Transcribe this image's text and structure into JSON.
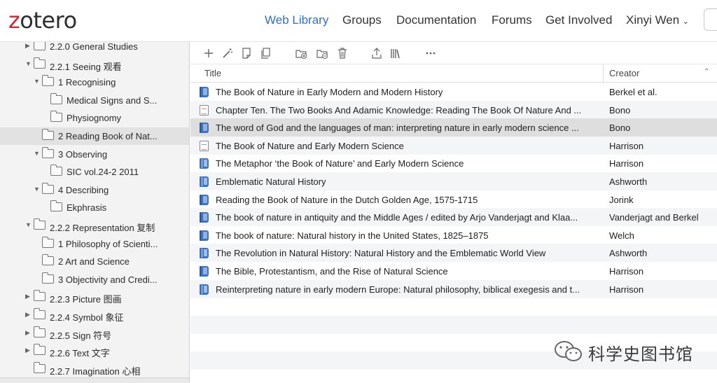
{
  "header": {
    "logo_first": "z",
    "logo_rest": "otero",
    "nav": [
      "Web Library",
      "Groups",
      "Documentation",
      "Forums",
      "Get Involved"
    ],
    "active_nav": "Web Library",
    "user": "Xinyi Wen"
  },
  "sidebar": {
    "items": [
      {
        "label": "2.2.0 General Studies",
        "expanded": false
      },
      {
        "label": "2.2.1 Seeing 观看",
        "expanded": true
      },
      {
        "label": "1 Recognising",
        "expanded": true
      },
      {
        "label": "Medical Signs and S...",
        "expanded": null
      },
      {
        "label": "Physiognomy",
        "expanded": null
      },
      {
        "label": "2 Reading Book of Nat...",
        "expanded": null,
        "selected": true
      },
      {
        "label": "3 Observing",
        "expanded": true
      },
      {
        "label": "SIC vol.24-2 2011",
        "expanded": null
      },
      {
        "label": "4 Describing",
        "expanded": true
      },
      {
        "label": "Ekphrasis",
        "expanded": null
      },
      {
        "label": "2.2.2 Representation 复制",
        "expanded": true
      },
      {
        "label": "1 Philosophy of Scienti...",
        "expanded": null
      },
      {
        "label": "2 Art and Science",
        "expanded": null
      },
      {
        "label": "3 Objectivity and Credi...",
        "expanded": null
      },
      {
        "label": "2.2.3 Picture 图画",
        "expanded": false
      },
      {
        "label": "2.2.4 Symbol 象征",
        "expanded": false
      },
      {
        "label": "2.2.5 Sign 符号",
        "expanded": false
      },
      {
        "label": "2.2.6 Text 文字",
        "expanded": false
      },
      {
        "label": "2.2.7 Imagination 心相",
        "expanded": null
      }
    ]
  },
  "toolbar": {
    "icons": [
      "plus-icon",
      "magic-wand-icon",
      "new-note-icon",
      "duplicate-icon",
      "add-to-collection-icon",
      "remove-from-collection-icon",
      "trash-icon",
      "export-icon",
      "library-icon",
      "more-icon"
    ]
  },
  "table": {
    "columns": {
      "title": "Title",
      "creator": "Creator"
    },
    "sort": "ascending",
    "rows": [
      {
        "type": "book",
        "title": "The Book of Nature in Early Modern and Modern History",
        "creator": "Berkel et al."
      },
      {
        "type": "chapter",
        "title": "Chapter Ten. The Two Books And Adamic Knowledge: Reading The Book Of Nature And ...",
        "creator": "Bono"
      },
      {
        "type": "book",
        "title": "The word of God and the languages of man: interpreting nature in early modern science ...",
        "creator": "Bono",
        "selected": true
      },
      {
        "type": "chapter",
        "title": "The Book of Nature and Early Modern Science",
        "creator": "Harrison"
      },
      {
        "type": "section",
        "title": "The Metaphor ‘the Book of Nature’ and Early Modern Science",
        "creator": "Harrison"
      },
      {
        "type": "section",
        "title": "Emblematic Natural History",
        "creator": "Ashworth"
      },
      {
        "type": "book",
        "title": "Reading the Book of Nature in the Dutch Golden Age, 1575-1715",
        "creator": "Jorink"
      },
      {
        "type": "book",
        "title": "The book of nature in antiquity and the Middle Ages / edited by Arjo Vanderjagt and Klaa...",
        "creator": "Vanderjagt and Berkel"
      },
      {
        "type": "book",
        "title": "The book of nature: Natural history in the United States, 1825–1875",
        "creator": "Welch"
      },
      {
        "type": "section",
        "title": "The Revolution in Natural History: Natural History and the Emblematic World View",
        "creator": "Ashworth"
      },
      {
        "type": "book",
        "title": "The Bible, Protestantism, and the Rise of Natural Science",
        "creator": "Harrison"
      },
      {
        "type": "section",
        "title": "Reinterpreting nature in early modern Europe: Natural philosophy, biblical exegesis and t...",
        "creator": "Harrison"
      }
    ]
  },
  "watermark": {
    "text": "科学史图书馆"
  },
  "colors": {
    "accent": "#2b70c9",
    "logo_red": "#cc2936",
    "selected_row": "#dedede",
    "sidebar_bg": "#f3f3f3"
  }
}
